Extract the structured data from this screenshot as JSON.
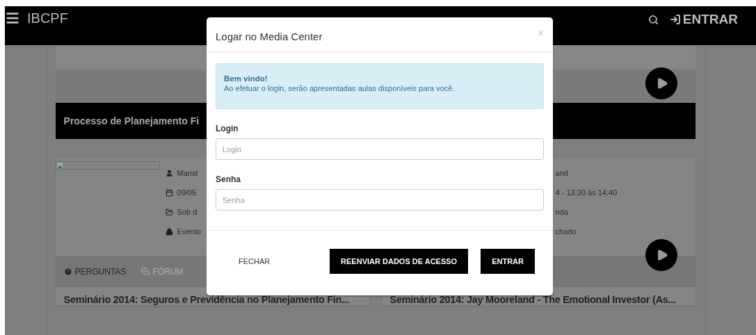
{
  "navbar": {
    "brand": "IBCPF",
    "login": "ENTRAR"
  },
  "featured": {
    "title": "Processo de Planejamento Fi"
  },
  "cards": [
    {
      "image": true,
      "meta": [
        {
          "kind": "person",
          "text": "Marist"
        },
        {
          "kind": "date",
          "text": "09/05"
        },
        {
          "kind": "folder",
          "text": "Sob d"
        },
        {
          "kind": "lock",
          "text": "Evento"
        }
      ],
      "tabs": [
        {
          "label": "PERGUNTAS",
          "disabled": false
        },
        {
          "label": "FÓRUM",
          "disabled": true
        }
      ],
      "title": "Seminário 2014: Seguros e Previdência no Planejamento Fin..."
    },
    {
      "image": false,
      "meta": [
        {
          "text": "and"
        },
        {
          "text": "4 - 13:30 ás 14:40"
        },
        {
          "text": "nda"
        },
        {
          "text": "chado"
        }
      ],
      "title": "Seminário 2014: Jay Mooreland - The Emotional Investor (As..."
    }
  ],
  "modal": {
    "title": "Logar no Media Center",
    "close": "×",
    "alert": {
      "heading": "Bem vindo!",
      "text": "Ao efetuar o login, serão apresentadas aulas disponíveis para você."
    },
    "fields": [
      {
        "label": "Login",
        "placeholder": "Login"
      },
      {
        "label": "Senha",
        "placeholder": "Senha"
      }
    ],
    "buttons": [
      {
        "kind": "flat",
        "label": "FECHAR"
      },
      {
        "kind": "solid",
        "label": "REENVIAR DADOS DE ACESSO"
      },
      {
        "kind": "solid",
        "label": "ENTRAR"
      }
    ]
  }
}
